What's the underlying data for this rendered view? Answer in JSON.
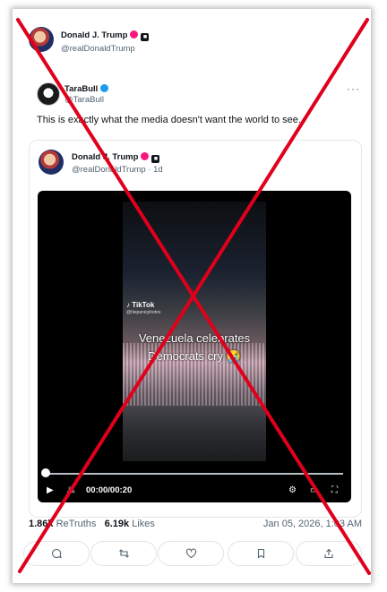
{
  "outer": {
    "name": "Donald J. Trump",
    "handle": "@realDonaldTrump"
  },
  "post": {
    "name": "TaraBull",
    "handle": "@TaraBull",
    "more": "···",
    "text": "This is exactly what the media doesn't want the world to see."
  },
  "quoted": {
    "name": "Donald J. Trump",
    "handle_time": "@realDonaldTrump · 1d",
    "video": {
      "watermark": "TikTok",
      "watermark_handle": "@hispanicphotos",
      "caption_line1": "Venezuela celebrates",
      "caption_line2": "Democrats cry 😭",
      "time": "00:00/00:20",
      "progress": 0.0
    }
  },
  "stats": {
    "retruths_count": "1.86k",
    "retruths_label": "ReTruths",
    "likes_count": "6.19k",
    "likes_label": "Likes",
    "date": "Jan 05, 2026, 1:03 AM"
  },
  "icons": {
    "reply": "reply-icon",
    "retruth": "retruth-icon",
    "like": "like-icon",
    "bookmark": "bookmark-icon",
    "share": "share-icon"
  },
  "colors": {
    "verified_red": "#f91880",
    "verified_blue": "#1d9bf0",
    "overlay_x": "#e0001b"
  }
}
